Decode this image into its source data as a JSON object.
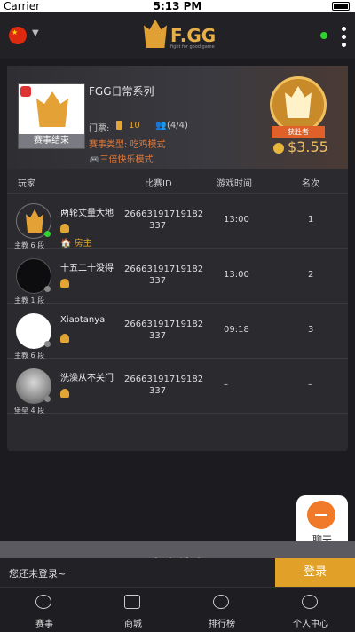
{
  "status_bar": {
    "carrier": "Carrier",
    "time": "5:13 PM"
  },
  "header": {
    "logo_text": "F.GG",
    "logo_sub": "fight for good game"
  },
  "match": {
    "status": "赛事结束",
    "title": "FGG日常系列",
    "ticket_label": "门票:",
    "ticket_value": "10",
    "players": "(4/4)",
    "type_label": "赛事类型:",
    "type_value": "吃鸡模式",
    "bonus": "三倍快乐模式",
    "winner_label": "获胜者",
    "prize": "$3.55"
  },
  "table": {
    "headers": [
      "玩家",
      "比赛ID",
      "游戏时间",
      "名次"
    ],
    "rows": [
      {
        "name": "两轮丈量大地",
        "rank": "主教 6 段",
        "match_id_1": "26663191719182",
        "match_id_2": "337",
        "time": "13:00",
        "place": "1",
        "host": "房主"
      },
      {
        "name": "十五二十没得",
        "rank": "主教 1 段",
        "match_id_1": "26663191719182",
        "match_id_2": "337",
        "time": "13:00",
        "place": "2"
      },
      {
        "name": "Xiaotanya",
        "rank": "主教 6 段",
        "match_id_1": "26663191719182",
        "match_id_2": "337",
        "time": "09:18",
        "place": "3"
      },
      {
        "name": "洗澡从不关门",
        "rank": "堡垒 4 段",
        "match_id_1": "26663191719182",
        "match_id_2": "337",
        "time": "–",
        "place": "–"
      }
    ]
  },
  "chat": {
    "label": "聊天"
  },
  "bottom": {
    "ended_text": "赛事结束",
    "login_prompt": "您还未登录~",
    "login_button": "登录"
  },
  "tabs": [
    "赛事",
    "商城",
    "排行榜",
    "个人中心"
  ]
}
